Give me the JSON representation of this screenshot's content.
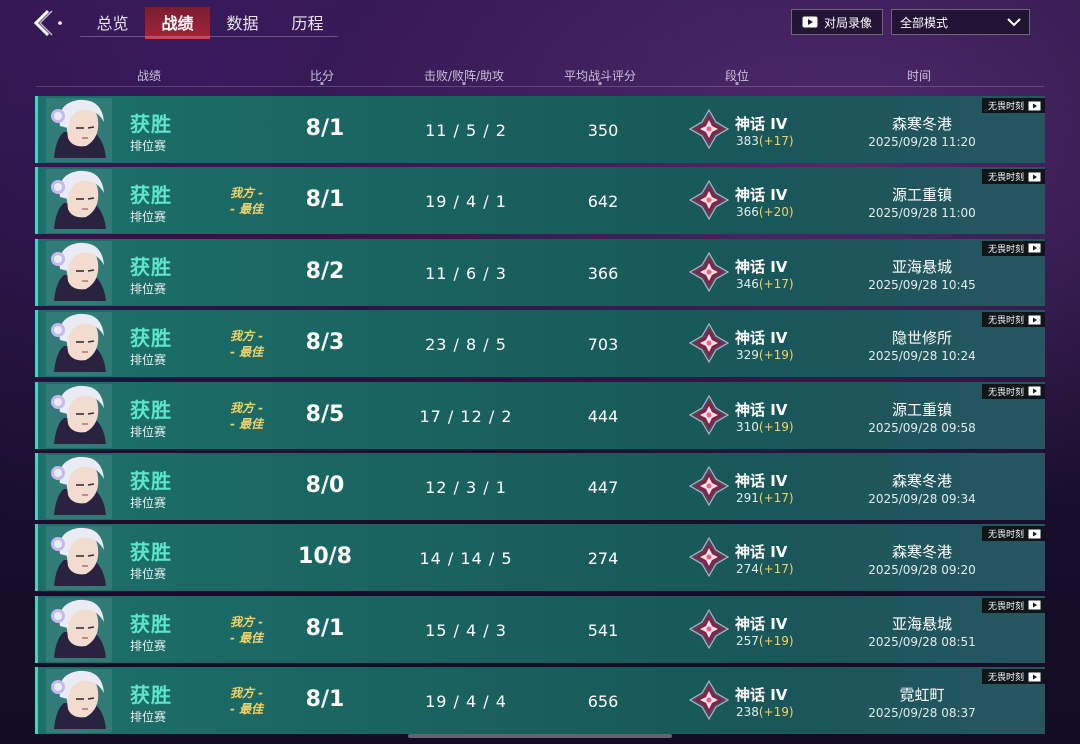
{
  "header": {
    "tabs": [
      {
        "label": "总览",
        "active": false
      },
      {
        "label": "战绩",
        "active": true
      },
      {
        "label": "数据",
        "active": false
      },
      {
        "label": "历程",
        "active": false
      }
    ],
    "replay_button": {
      "label": "对局录像",
      "icon": "video-icon"
    },
    "mode_select": {
      "value": "全部模式",
      "icon": "chevron-down-icon"
    }
  },
  "columns": {
    "record": "战绩",
    "score": "比分",
    "kda": "击败/败阵/助攻",
    "rating": "平均战斗评分",
    "rank": "段位",
    "time": "时间"
  },
  "colors": {
    "win_text": "#5ee6c9",
    "row_accent": "#3fd6c2",
    "best_badge": "#f1d26a",
    "active_tab": "#a1233a"
  },
  "matches": [
    {
      "result": "获胜",
      "mode": "排位赛",
      "best": false,
      "best_l1": "",
      "best_l2": "",
      "score": "8/1",
      "kda": "11 / 5 / 2",
      "rating": "350",
      "rank": "神话 IV",
      "rank_points": "383",
      "rank_delta": "(+17)",
      "map": "森寒冬港",
      "date": "2025/09/28 11:20",
      "tag": "无畏时刻"
    },
    {
      "result": "获胜",
      "mode": "排位赛",
      "best": true,
      "best_l1": "我方 -",
      "best_l2": "- 最佳",
      "score": "8/1",
      "kda": "19 / 4 / 1",
      "rating": "642",
      "rank": "神话 IV",
      "rank_points": "366",
      "rank_delta": "(+20)",
      "map": "源工重镇",
      "date": "2025/09/28 11:00",
      "tag": "无畏时刻"
    },
    {
      "result": "获胜",
      "mode": "排位赛",
      "best": false,
      "best_l1": "",
      "best_l2": "",
      "score": "8/2",
      "kda": "11 / 6 / 3",
      "rating": "366",
      "rank": "神话 IV",
      "rank_points": "346",
      "rank_delta": "(+17)",
      "map": "亚海悬城",
      "date": "2025/09/28 10:45",
      "tag": "无畏时刻"
    },
    {
      "result": "获胜",
      "mode": "排位赛",
      "best": true,
      "best_l1": "我方 -",
      "best_l2": "- 最佳",
      "score": "8/3",
      "kda": "23 / 8 / 5",
      "rating": "703",
      "rank": "神话 IV",
      "rank_points": "329",
      "rank_delta": "(+19)",
      "map": "隐世修所",
      "date": "2025/09/28 10:24",
      "tag": "无畏时刻"
    },
    {
      "result": "获胜",
      "mode": "排位赛",
      "best": true,
      "best_l1": "我方 -",
      "best_l2": "- 最佳",
      "score": "8/5",
      "kda": "17 / 12 / 2",
      "rating": "444",
      "rank": "神话 IV",
      "rank_points": "310",
      "rank_delta": "(+19)",
      "map": "源工重镇",
      "date": "2025/09/28 09:58",
      "tag": "无畏时刻"
    },
    {
      "result": "获胜",
      "mode": "排位赛",
      "best": false,
      "best_l1": "",
      "best_l2": "",
      "score": "8/0",
      "kda": "12 / 3 / 1",
      "rating": "447",
      "rank": "神话 IV",
      "rank_points": "291",
      "rank_delta": "(+17)",
      "map": "森寒冬港",
      "date": "2025/09/28 09:34",
      "tag": ""
    },
    {
      "result": "获胜",
      "mode": "排位赛",
      "best": false,
      "best_l1": "",
      "best_l2": "",
      "score": "10/8",
      "kda": "14 / 14 / 5",
      "rating": "274",
      "rank": "神话 IV",
      "rank_points": "274",
      "rank_delta": "(+17)",
      "map": "森寒冬港",
      "date": "2025/09/28 09:20",
      "tag": "无畏时刻"
    },
    {
      "result": "获胜",
      "mode": "排位赛",
      "best": true,
      "best_l1": "我方 -",
      "best_l2": "- 最佳",
      "score": "8/1",
      "kda": "15 / 4 / 3",
      "rating": "541",
      "rank": "神话 IV",
      "rank_points": "257",
      "rank_delta": "(+19)",
      "map": "亚海悬城",
      "date": "2025/09/28 08:51",
      "tag": "无畏时刻"
    },
    {
      "result": "获胜",
      "mode": "排位赛",
      "best": true,
      "best_l1": "我方 -",
      "best_l2": "- 最佳",
      "score": "8/1",
      "kda": "19 / 4 / 4",
      "rating": "656",
      "rank": "神话 IV",
      "rank_points": "238",
      "rank_delta": "(+19)",
      "map": "霓虹町",
      "date": "2025/09/28 08:37",
      "tag": "无畏时刻"
    }
  ]
}
